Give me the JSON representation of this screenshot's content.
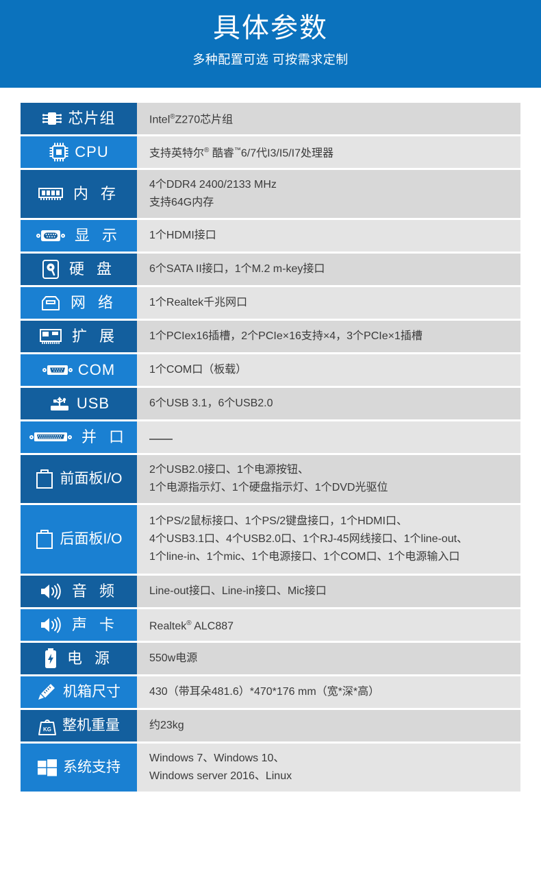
{
  "header": {
    "title": "具体参数",
    "subtitle": "多种配置可选 可按需求定制",
    "bg_color": "#0b72bd"
  },
  "colors": {
    "label_dark": "#135f9e",
    "label_light": "#1a80d2",
    "value_dark": "#d8d8d8",
    "value_light": "#e4e4e4",
    "label_text": "#ffffff",
    "value_text": "#3a3a3a"
  },
  "spec_rows": [
    {
      "icon": "chipset-icon",
      "label": "芯片组",
      "lines": [
        "Intel®Z270芯片组"
      ]
    },
    {
      "icon": "cpu-icon",
      "label": "CPU",
      "lines": [
        "支持英特尔® 酷睿™6/7代I3/I5/I7处理器"
      ]
    },
    {
      "icon": "memory-icon",
      "label": "内 存",
      "lines": [
        "4个DDR4 2400/2133 MHz",
        "支持64G内存"
      ]
    },
    {
      "icon": "vga-display-icon",
      "label": "显 示",
      "lines": [
        "1个HDMI接口"
      ]
    },
    {
      "icon": "harddisk-icon",
      "label": "硬 盘",
      "lines": [
        "6个SATA II接口，1个M.2 m-key接口"
      ]
    },
    {
      "icon": "network-rj45-icon",
      "label": "网 络",
      "lines": [
        "1个Realtek千兆网口"
      ]
    },
    {
      "icon": "expansion-slot-icon",
      "label": "扩 展",
      "lines": [
        "1个PCIex16插槽，2个PCIe×16支持×4，3个PCIe×1插槽"
      ]
    },
    {
      "icon": "com-serial-port-icon",
      "label": "COM",
      "lines": [
        "1个COM口（板载）"
      ]
    },
    {
      "icon": "usb-icon",
      "label": "USB",
      "lines": [
        "6个USB 3.1，6个USB2.0"
      ]
    },
    {
      "icon": "parallel-port-icon",
      "label": "并 口",
      "lines": [
        "—"
      ]
    },
    {
      "icon": "front-panel-io-icon",
      "label": "前面板I/O",
      "lines": [
        "2个USB2.0接口、1个电源按钮、",
        "1个电源指示灯、1个硬盘指示灯、1个DVD光驱位"
      ]
    },
    {
      "icon": "rear-panel-io-icon",
      "label": "后面板I/O",
      "lines": [
        "1个PS/2鼠标接口、1个PS/2键盘接口，1个HDMI口、",
        "4个USB3.1口、4个USB2.0口、1个RJ-45网线接口、1个line-out、",
        "1个line-in、1个mic、1个电源接口、1个COM口、1个电源输入口"
      ]
    },
    {
      "icon": "audio-speaker-icon",
      "label": "音 频",
      "lines": [
        "Line-out接口、Line-in接口、Mic接口"
      ]
    },
    {
      "icon": "sound-card-icon",
      "label": "声 卡",
      "lines": [
        "Realtek® ALC887"
      ]
    },
    {
      "icon": "power-battery-icon",
      "label": "电 源",
      "lines": [
        "550w电源"
      ]
    },
    {
      "icon": "ruler-pencil-icon",
      "label": "机箱尺寸",
      "lines": [
        "430（带耳朵481.6）*470*176 mm（宽*深*高）"
      ]
    },
    {
      "icon": "weight-kg-icon",
      "label": "整机重量",
      "lines": [
        "约23kg"
      ]
    },
    {
      "icon": "windows-logo-icon",
      "label": "系统支持",
      "lines": [
        "Windows 7、Windows 10、",
        "Windows server 2016、Linux"
      ]
    }
  ]
}
